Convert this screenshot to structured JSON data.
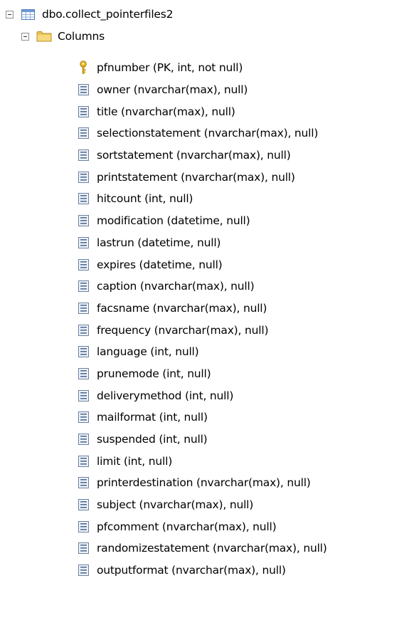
{
  "tree": {
    "table": {
      "label": "dbo.collect_pointerfiles2",
      "icon": "table-icon",
      "expanded": true
    },
    "columns_folder": {
      "label": "Columns",
      "icon": "folder-icon",
      "expanded": true
    },
    "columns": [
      {
        "label": "pfnumber (PK, int, not null)",
        "icon": "primary-key-icon"
      },
      {
        "label": "owner (nvarchar(max), null)",
        "icon": "column-icon"
      },
      {
        "label": "title (nvarchar(max), null)",
        "icon": "column-icon"
      },
      {
        "label": "selectionstatement (nvarchar(max), null)",
        "icon": "column-icon"
      },
      {
        "label": "sortstatement (nvarchar(max), null)",
        "icon": "column-icon"
      },
      {
        "label": "printstatement (nvarchar(max), null)",
        "icon": "column-icon"
      },
      {
        "label": "hitcount (int, null)",
        "icon": "column-icon"
      },
      {
        "label": "modification (datetime, null)",
        "icon": "column-icon"
      },
      {
        "label": "lastrun (datetime, null)",
        "icon": "column-icon"
      },
      {
        "label": "expires (datetime, null)",
        "icon": "column-icon"
      },
      {
        "label": "caption (nvarchar(max), null)",
        "icon": "column-icon"
      },
      {
        "label": "facsname (nvarchar(max), null)",
        "icon": "column-icon"
      },
      {
        "label": "frequency (nvarchar(max), null)",
        "icon": "column-icon"
      },
      {
        "label": "language (int, null)",
        "icon": "column-icon"
      },
      {
        "label": "prunemode (int, null)",
        "icon": "column-icon"
      },
      {
        "label": "deliverymethod (int, null)",
        "icon": "column-icon"
      },
      {
        "label": "mailformat (int, null)",
        "icon": "column-icon"
      },
      {
        "label": "suspended (int, null)",
        "icon": "column-icon"
      },
      {
        "label": "limit (int, null)",
        "icon": "column-icon"
      },
      {
        "label": "printerdestination (nvarchar(max), null)",
        "icon": "column-icon"
      },
      {
        "label": "subject (nvarchar(max), null)",
        "icon": "column-icon"
      },
      {
        "label": "pfcomment (nvarchar(max), null)",
        "icon": "column-icon"
      },
      {
        "label": "randomizestatement (nvarchar(max), null)",
        "icon": "column-icon"
      },
      {
        "label": "outputformat (nvarchar(max), null)",
        "icon": "column-icon"
      }
    ]
  }
}
